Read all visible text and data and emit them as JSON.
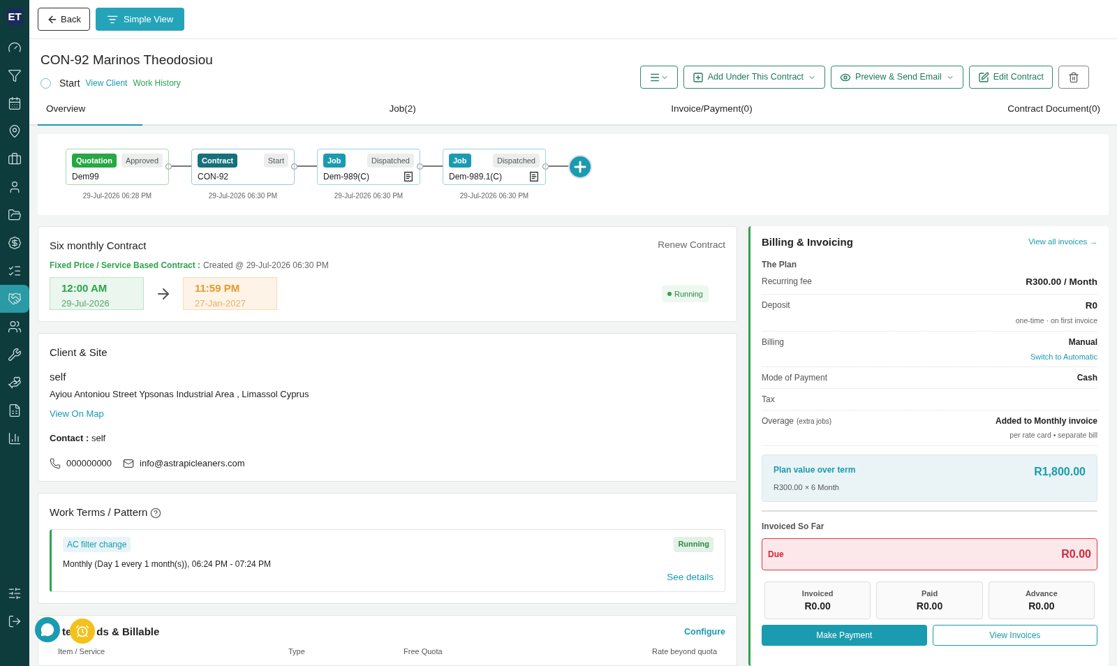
{
  "sidebar": {
    "logo": "ET",
    "items": [
      {
        "selected": false
      },
      {
        "selected": false
      },
      {
        "selected": false
      },
      {
        "selected": false
      },
      {
        "selected": false
      },
      {
        "selected": false
      },
      {
        "selected": false
      },
      {
        "selected": false
      },
      {
        "selected": false
      },
      {
        "selected": true
      },
      {
        "selected": false
      },
      {
        "selected": false
      },
      {
        "selected": false
      },
      {
        "selected": false
      },
      {
        "selected": false
      }
    ],
    "bottom_items": [
      {
        "selected": false
      },
      {
        "selected": false
      }
    ]
  },
  "toolbar": {
    "back": "Back",
    "simple_view": "Simple View"
  },
  "header": {
    "title": "CON-92 Marinos Theodosiou",
    "status": "Start",
    "links": [
      {
        "label": "View Client",
        "color": "#1a9bb0"
      },
      {
        "label": "Work History",
        "color": "#2ea44f"
      }
    ],
    "actions": [
      "Add Under This Contract",
      "Preview & Send Email",
      "Edit Contract"
    ]
  },
  "tabs": [
    {
      "label": "Overview",
      "selected": true
    },
    {
      "label": "Job(2)",
      "selected": false
    },
    {
      "label": "Invoice/Payment(0)",
      "selected": false
    },
    {
      "label": "Contract Document(0)",
      "selected": false
    }
  ],
  "flow": [
    {
      "kind": "quotation",
      "type_label": "Quotation",
      "status": "Approved",
      "code": "Dem99",
      "date": "29-Jul-2026 06:28 PM"
    },
    {
      "kind": "contract",
      "type_label": "Contract",
      "status": "Start",
      "code": "CON-92",
      "date": "29-Jul-2026 06:30 PM"
    },
    {
      "kind": "job",
      "type_label": "Job",
      "status": "Dispatched",
      "code": "Dem-989(C)",
      "date": "29-Jul-2026 06:30 PM"
    },
    {
      "kind": "job",
      "type_label": "Job",
      "status": "Dispatched",
      "code": "Dem-989.1(C)",
      "date": "29-Jul-2026 06:30 PM"
    }
  ],
  "contract": {
    "title": "Six monthly Contract",
    "renew": "Renew Contract",
    "type": "Fixed Price / Service Based Contract :",
    "created": "Created @ 29-Jul-2026 06:30 PM",
    "start_time": "12:00 AM",
    "start_date": "29-Jul-2026",
    "end_time": "11:59 PM",
    "end_date": "27-Jan-2027",
    "status": "Running"
  },
  "client": {
    "title": "Client & Site",
    "name": "self",
    "address": "Ayiou Antoniou Street Ypsonas Industrial Area , Limassol Cyprus",
    "map_link": "View On Map",
    "contact": "**Contact :** self",
    "phone": "000000000",
    "email": "info@astrapicleaners.com"
  },
  "work_terms": {
    "title": "Work Terms / Pattern",
    "items": [
      {
        "tag": "AC filter change",
        "status": "Running",
        "schedule": "Monthly (Day 1 every 1 month(s)), 06:24 PM - 07:24 PM",
        "link": "See details"
      }
    ]
  },
  "billable": {
    "title_parts": [
      "te",
      "ds & Billable"
    ],
    "configure": "Configure",
    "columns": [
      "Item / Service",
      "Type",
      "Free Quota",
      "Rate beyond quota"
    ]
  },
  "billing": {
    "title": "Billing & Invoicing",
    "view_all": "View all invoices →",
    "section": "The Plan",
    "rows": [
      {
        "label": "Recurring fee",
        "value": "R300.00 / Month"
      },
      {
        "label": "Deposit",
        "value": "R0",
        "note": "one-time · on first invoice"
      },
      {
        "label": "Billing",
        "value": "Manual",
        "link": "Switch to Automatic"
      },
      {
        "label": "Mode of Payment",
        "value": "Cash"
      },
      {
        "label": "Tax"
      },
      {
        "label": "Overage",
        "label_note": "(extra jobs)",
        "value": "Added to Monthly invoice",
        "note": "per rate card • separate bill"
      }
    ],
    "plan_value": {
      "label": "Plan value over term",
      "amount": "R1,800.00",
      "detail": "R300.00 × 6 Month"
    },
    "invoiced_title": "Invoiced So Far",
    "due": {
      "label": "Due",
      "amount": "R0.00"
    },
    "stats": [
      {
        "label": "Invoiced",
        "value": "R0.00"
      },
      {
        "label": "Paid",
        "value": "R0.00"
      },
      {
        "label": "Advance",
        "value": "R0.00"
      }
    ],
    "buttons": [
      "Make Payment",
      "View Invoices"
    ]
  }
}
